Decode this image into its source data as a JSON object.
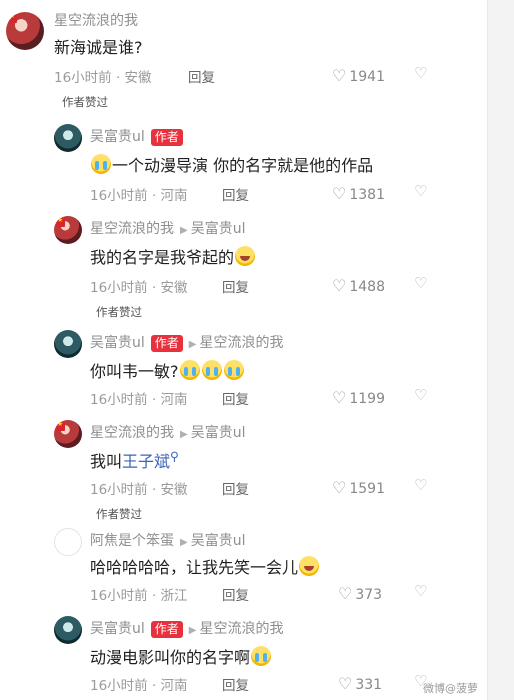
{
  "comments": [
    {
      "user": "星空流浪的我",
      "text": "新海诚是谁?",
      "time_loc": "16小时前 · 安徽",
      "reply_label": "回复",
      "likes": "1941",
      "author_liked": "作者赞过"
    },
    {
      "user": "吴富贵ul",
      "badge": "作者",
      "text": "一个动漫导演 你的名字就是他的作品",
      "time_loc": "16小时前 · 河南",
      "reply_label": "回复",
      "likes": "1381"
    },
    {
      "user": "星空流浪的我",
      "reply_to": "吴富贵ul",
      "text": "我的名字是我爷起的",
      "time_loc": "16小时前 · 安徽",
      "reply_label": "回复",
      "likes": "1488",
      "author_liked": "作者赞过"
    },
    {
      "user": "吴富贵ul",
      "badge": "作者",
      "reply_to": "星空流浪的我",
      "text": "你叫韦一敏?",
      "time_loc": "16小时前 · 河南",
      "reply_label": "回复",
      "likes": "1199"
    },
    {
      "user": "星空流浪的我",
      "reply_to": "吴富贵ul",
      "text_prefix": "我叫",
      "text_link": "王子斌",
      "time_loc": "16小时前 · 安徽",
      "reply_label": "回复",
      "likes": "1591",
      "author_liked": "作者赞过"
    },
    {
      "user": "阿焦是个笨蛋",
      "reply_to": "吴富贵ul",
      "text": "哈哈哈哈哈，让我先笑一会儿",
      "time_loc": "16小时前 · 浙江",
      "reply_label": "回复",
      "likes": "373"
    },
    {
      "user": "吴富贵ul",
      "badge": "作者",
      "reply_to": "星空流浪的我",
      "text": "动漫电影叫你的名字啊",
      "time_loc": "16小时前 · 河南",
      "reply_label": "回复",
      "likes": "331"
    }
  ],
  "watermark": "微博@菠萝",
  "icons": {
    "like": "heart-outline-icon",
    "dislike": "broken-heart-outline-icon",
    "reply_arrow": "triangle-right-icon"
  }
}
